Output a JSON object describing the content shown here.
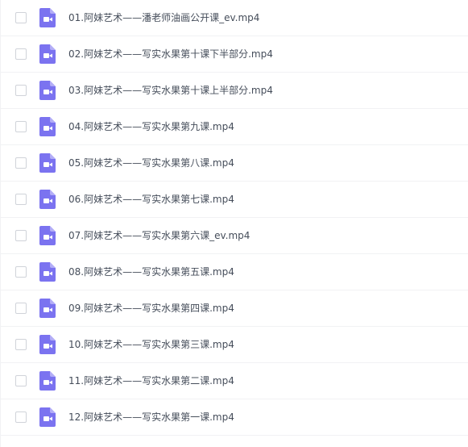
{
  "file_list": {
    "icon": "video-file-icon",
    "icon_color": "#7b73f0",
    "files": [
      {
        "name": "01.阿妹艺术——潘老师油画公开课_ev.mp4"
      },
      {
        "name": "02.阿妹艺术——写实水果第十课下半部分.mp4"
      },
      {
        "name": "03.阿妹艺术——写实水果第十课上半部分.mp4"
      },
      {
        "name": "04.阿妹艺术——写实水果第九课.mp4"
      },
      {
        "name": "05.阿妹艺术——写实水果第八课.mp4"
      },
      {
        "name": "06.阿妹艺术——写实水果第七课.mp4"
      },
      {
        "name": "07.阿妹艺术——写实水果第六课_ev.mp4"
      },
      {
        "name": "08.阿妹艺术——写实水果第五课.mp4"
      },
      {
        "name": "09.阿妹艺术——写实水果第四课.mp4"
      },
      {
        "name": "10.阿妹艺术——写实水果第三课.mp4"
      },
      {
        "name": "11.阿妹艺术——写实水果第二课.mp4"
      },
      {
        "name": "12.阿妹艺术——写实水果第一课.mp4"
      }
    ]
  }
}
